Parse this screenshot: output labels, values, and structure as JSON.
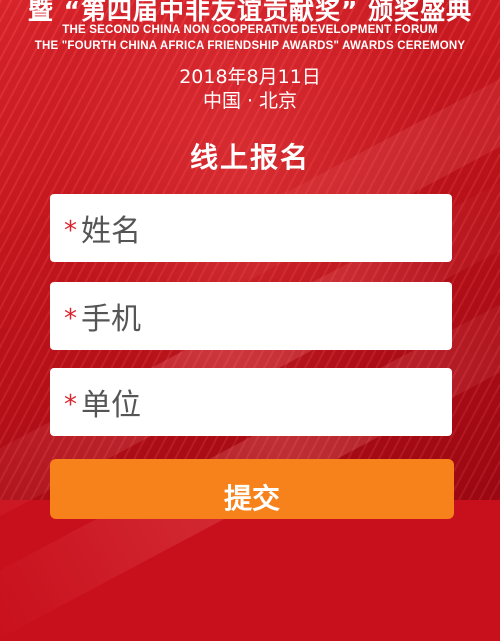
{
  "header": {
    "cn_title": "暨 “第四届中非友谊贡献奖” 颁奖盛典",
    "en_line1": "THE SECOND CHINA NON COOPERATIVE DEVELOPMENT FORUM",
    "en_line2": "THE \"FOURTH CHINA AFRICA FRIENDSHIP AWARDS\" AWARDS CEREMONY",
    "date": "2018年8月11日",
    "location": "中国 · 北京"
  },
  "form": {
    "title": "线上报名",
    "fields": [
      {
        "required_mark": "*",
        "placeholder": "姓名"
      },
      {
        "required_mark": "*",
        "placeholder": "手机"
      },
      {
        "required_mark": "*",
        "placeholder": "单位"
      }
    ],
    "submit_label": "提交"
  },
  "colors": {
    "background": "#c8101c",
    "submit": "#f7811a",
    "required": "#d9262d"
  }
}
